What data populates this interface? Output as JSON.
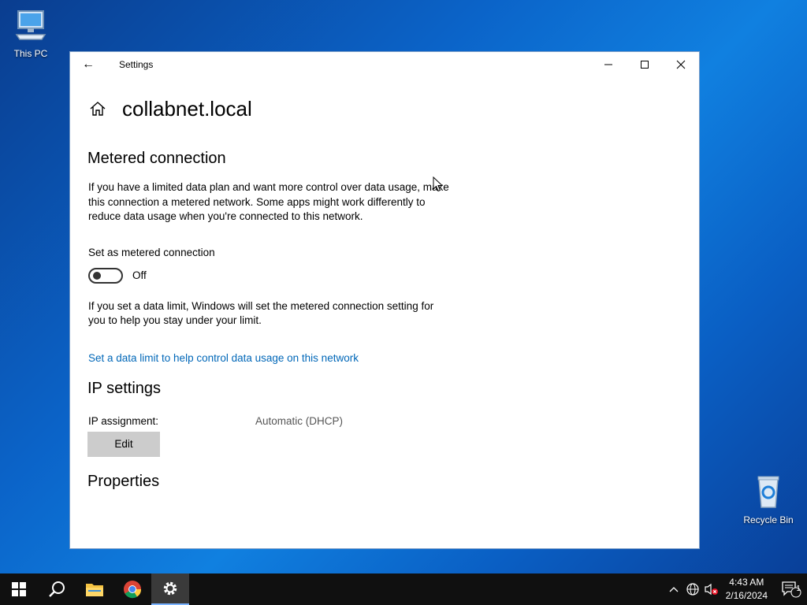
{
  "desktop": {
    "icons": [
      {
        "label": "This PC"
      },
      {
        "label": "Recycle Bin"
      }
    ]
  },
  "window": {
    "app_title": "Settings",
    "page_title": "collabnet.local",
    "metered": {
      "heading": "Metered connection",
      "description": "If you have a limited data plan and want more control over data usage, make this connection a metered network. Some apps might work differently to reduce data usage when you're connected to this network.",
      "toggle_label": "Set as metered connection",
      "toggle_state": "Off",
      "toggle_on": false,
      "limit_note": "If you set a data limit, Windows will set the metered connection setting for you to help you stay under your limit.",
      "limit_link": "Set a data limit to help control data usage on this network"
    },
    "ip": {
      "heading": "IP settings",
      "assignment_label": "IP assignment:",
      "assignment_value": "Automatic (DHCP)",
      "edit_label": "Edit"
    },
    "properties": {
      "heading": "Properties"
    }
  },
  "taskbar": {
    "time": "4:43 AM",
    "date": "2/16/2024",
    "notification_count": "1"
  },
  "colors": {
    "accent": "#0067b8",
    "taskbar": "#101010"
  }
}
